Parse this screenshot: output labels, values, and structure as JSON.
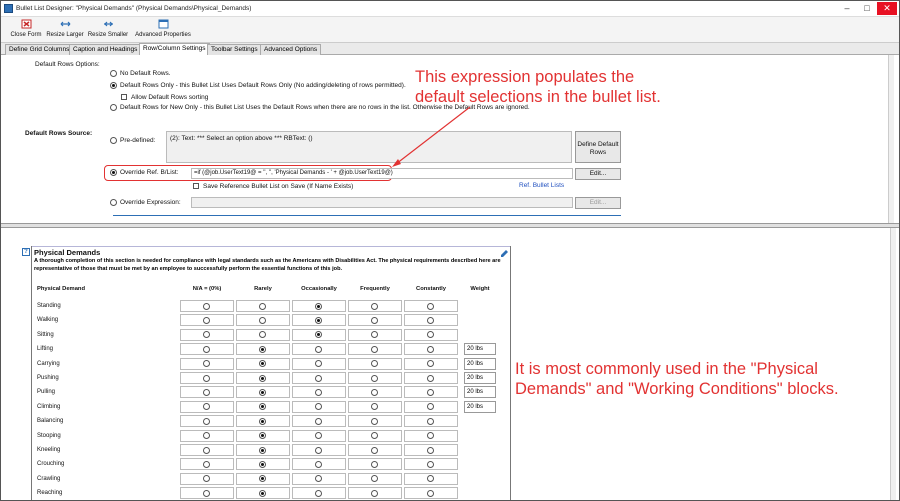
{
  "window": {
    "title": "Bullet List Designer: \"Physical Demands\" (Physical Demands\\Physical_Demands)"
  },
  "ribbon": [
    {
      "label": "Close Form",
      "icon": "close-form-icon"
    },
    {
      "label": "Resize Larger",
      "icon": "resize-larger-icon"
    },
    {
      "label": "Resize Smaller",
      "icon": "resize-smaller-icon"
    },
    {
      "label": "Advanced Properties",
      "icon": "advanced-properties-icon"
    }
  ],
  "tabs": [
    "Define Grid Columns",
    "Caption and Headings",
    "Row/Column Settings",
    "Toolbar Settings",
    "Advanced Options"
  ],
  "active_tab": "Row/Column Settings",
  "default_rows": {
    "label": "Default Rows Options:",
    "options": [
      "No Default Rows.",
      "Default Rows Only - this Bullet List Uses Default Rows Only  (No adding/deleting of rows permitted).",
      "Default Rows for New Only - this Bullet List Uses the Default Rows when there are no rows in the list. Otherwise the Default Rows are ignored."
    ],
    "selected": 1,
    "sorting_label": "Allow Default Rows sorting"
  },
  "source": {
    "label": "Default Rows Source:",
    "predefined_label": "Pre-defined:",
    "predefined_text": "(2):  Text: *** Select an option above *** RBText:  ()",
    "define_button": "Define Default Rows",
    "override_label": "Override Ref. B/List:",
    "override_value": "=if (@job.UserText19@ = '', '', 'Physical Demands - ' + @job.UserText19@)",
    "edit_label": "Edit...",
    "save_ref_label": "Save Reference Bullet List on Save (If Name Exists)",
    "ref_link": "Ref. Bullet Lists",
    "override_expr_label": "Override Expression:",
    "edit2_label": "Edit..."
  },
  "annotations": {
    "top": [
      "This expression populates the",
      "default selections in the bullet list."
    ],
    "bottom": [
      "It is most commonly used in the \"Physical",
      "Demands\" and \"Working Conditions\" blocks."
    ]
  },
  "physical_demands": {
    "help": "?",
    "title": "Physical Demands",
    "description": "A thorough completion of this section is needed for compliance with legal standards such as the Americans with Disabilities Act. The physical requirements described here are representative of those that must be met by an employee to successfully perform the essential functions of this job.",
    "columns": [
      "Physical Demand",
      "N/A = (0%)",
      "Rarely",
      "Occasionally",
      "Frequently",
      "Constantly",
      "Weight"
    ],
    "rows": [
      {
        "name": "Standing",
        "sel": 2,
        "weight": ""
      },
      {
        "name": "Walking",
        "sel": 2,
        "weight": ""
      },
      {
        "name": "Sitting",
        "sel": 2,
        "weight": ""
      },
      {
        "name": "Lifting",
        "sel": 1,
        "weight": "20 lbs"
      },
      {
        "name": "Carrying",
        "sel": 1,
        "weight": "20 lbs"
      },
      {
        "name": "Pushing",
        "sel": 1,
        "weight": "20 lbs"
      },
      {
        "name": "Pulling",
        "sel": 1,
        "weight": "20 lbs"
      },
      {
        "name": "Climbing",
        "sel": 1,
        "weight": "20 lbs"
      },
      {
        "name": "Balancing",
        "sel": 1,
        "weight": ""
      },
      {
        "name": "Stooping",
        "sel": 1,
        "weight": ""
      },
      {
        "name": "Kneeling",
        "sel": 1,
        "weight": ""
      },
      {
        "name": "Crouching",
        "sel": 1,
        "weight": ""
      },
      {
        "name": "Crawling",
        "sel": 1,
        "weight": ""
      },
      {
        "name": "Reaching",
        "sel": 1,
        "weight": ""
      }
    ]
  },
  "colors": {
    "annotation": "#e23232",
    "link": "#1f4fbf",
    "accent": "#2d6fb5"
  }
}
